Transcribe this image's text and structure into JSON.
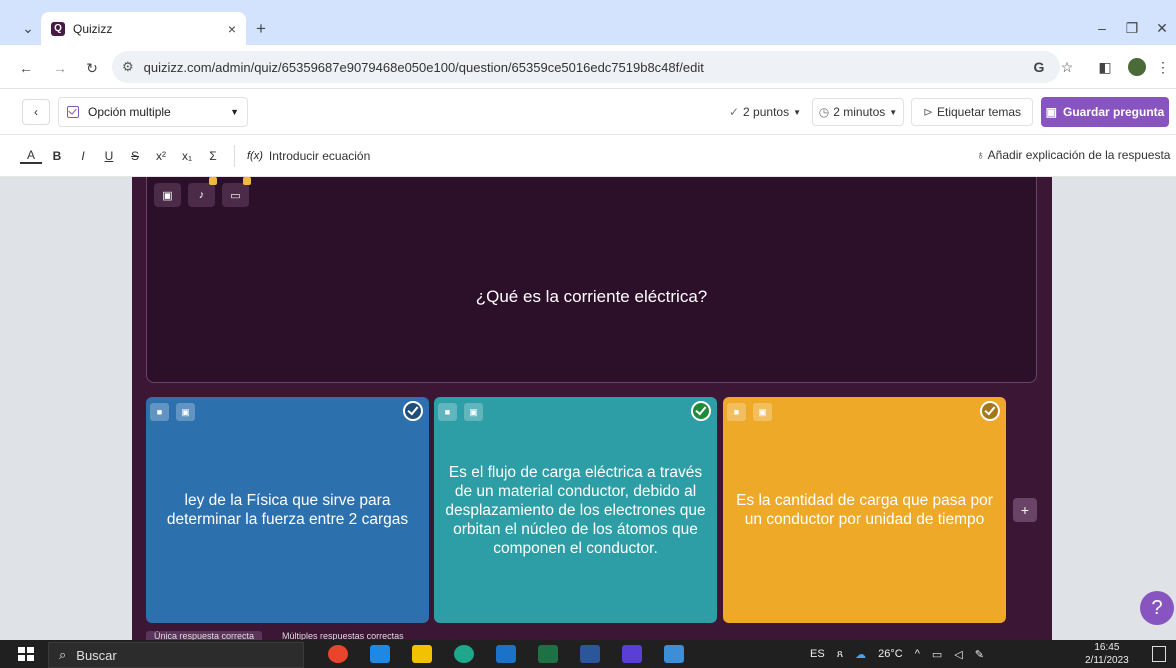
{
  "browser": {
    "tab_title": "Quizizz",
    "url": "quizizz.com/admin/quiz/65359687e9079468e050e100/question/65359ce5016edc7519b8c48f/edit"
  },
  "toolbar": {
    "question_type": "Opción multiple",
    "points": "2 puntos",
    "time": "2 minutos",
    "tag_topics": "Etiquetar temas",
    "save_label": "Guardar pregunta"
  },
  "format_bar": {
    "buttons": [
      "A",
      "B",
      "I",
      "U",
      "S",
      "x²",
      "x₁",
      "Σ"
    ],
    "equation_label": "Introducir ecuación",
    "explanation_label": "Añadir explicación de la respuesta"
  },
  "question": {
    "text": "¿Qué es la corriente eléctrica?"
  },
  "options": [
    {
      "text": "ley de la Física que sirve para determinar la fuerza entre 2 cargas",
      "color": "#2d70ae",
      "correct": false
    },
    {
      "text": "Es el flujo de carga eléctrica a través de un material conductor, debido al desplazamiento de los electrones que orbitan el núcleo de los átomos que componen el conductor.",
      "color": "#2d9da6",
      "correct": true
    },
    {
      "text": "Es la cantidad de carga que pasa por un conductor por unidad de tiempo",
      "color": "#efa929",
      "correct": false
    }
  ],
  "mode_tabs": [
    "Única respuesta correcta",
    "Múltiples respuestas correctas"
  ],
  "taskbar": {
    "search_placeholder": "Buscar",
    "language": "ES",
    "weather": "26°C",
    "time": "16:45",
    "date": "2/11/2023"
  },
  "colors": {
    "accent": "#8854c0",
    "editor_bg": "#3b1635"
  }
}
